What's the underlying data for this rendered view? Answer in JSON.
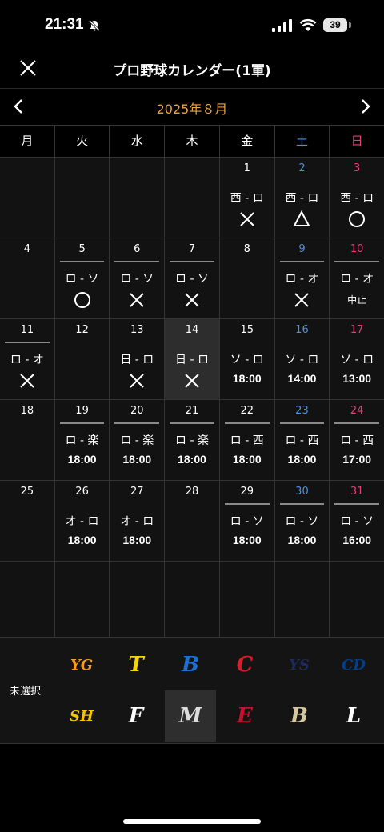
{
  "status": {
    "time": "21:31",
    "battery": "39"
  },
  "header": {
    "title": "プロ野球カレンダー(1軍)"
  },
  "calendar": {
    "month_label": "2025年８月",
    "weekdays": [
      "月",
      "火",
      "水",
      "木",
      "金",
      "土",
      "日"
    ],
    "weeks": [
      [
        {
          "day": ""
        },
        {
          "day": ""
        },
        {
          "day": ""
        },
        {
          "day": ""
        },
        {
          "day": "1",
          "match": "西 - ロ",
          "result": "x"
        },
        {
          "day": "2",
          "match": "西 - ロ",
          "result": "triangle"
        },
        {
          "day": "3",
          "match": "西 - ロ",
          "result": "o"
        }
      ],
      [
        {
          "day": "4"
        },
        {
          "day": "5",
          "match": "ロ - ソ",
          "result": "o",
          "line": true
        },
        {
          "day": "6",
          "match": "ロ - ソ",
          "result": "x",
          "line": true
        },
        {
          "day": "7",
          "match": "ロ - ソ",
          "result": "x",
          "line": true
        },
        {
          "day": "8"
        },
        {
          "day": "9",
          "match": "ロ - オ",
          "result": "x",
          "line": true
        },
        {
          "day": "10",
          "match": "ロ - オ",
          "note": "中止",
          "line": true
        }
      ],
      [
        {
          "day": "11",
          "match": "ロ - オ",
          "result": "x",
          "line": true
        },
        {
          "day": "12"
        },
        {
          "day": "13",
          "match": "日 - ロ",
          "result": "x"
        },
        {
          "day": "14",
          "match": "日 - ロ",
          "result": "x",
          "today": true
        },
        {
          "day": "15",
          "match": "ソ - ロ",
          "time": "18:00"
        },
        {
          "day": "16",
          "match": "ソ - ロ",
          "time": "14:00"
        },
        {
          "day": "17",
          "match": "ソ - ロ",
          "time": "13:00"
        }
      ],
      [
        {
          "day": "18"
        },
        {
          "day": "19",
          "match": "ロ - 楽",
          "time": "18:00",
          "line": true
        },
        {
          "day": "20",
          "match": "ロ - 楽",
          "time": "18:00",
          "line": true
        },
        {
          "day": "21",
          "match": "ロ - 楽",
          "time": "18:00",
          "line": true
        },
        {
          "day": "22",
          "match": "ロ - 西",
          "time": "18:00",
          "line": true
        },
        {
          "day": "23",
          "match": "ロ - 西",
          "time": "18:00",
          "line": true
        },
        {
          "day": "24",
          "match": "ロ - 西",
          "time": "17:00",
          "line": true
        }
      ],
      [
        {
          "day": "25"
        },
        {
          "day": "26",
          "match": "オ - ロ",
          "time": "18:00"
        },
        {
          "day": "27",
          "match": "オ - ロ",
          "time": "18:00"
        },
        {
          "day": "28"
        },
        {
          "day": "29",
          "match": "ロ - ソ",
          "time": "18:00",
          "line": true
        },
        {
          "day": "30",
          "match": "ロ - ソ",
          "time": "18:00",
          "line": true
        },
        {
          "day": "31",
          "match": "ロ - ソ",
          "time": "16:00",
          "line": true
        }
      ],
      [
        {
          "day": ""
        },
        {
          "day": ""
        },
        {
          "day": ""
        },
        {
          "day": ""
        },
        {
          "day": ""
        },
        {
          "day": ""
        },
        {
          "day": ""
        }
      ]
    ]
  },
  "teams": {
    "unselected_label": "未選択",
    "row1": [
      {
        "name": "giants-logo",
        "icon": "YG",
        "color": "#f29b1d"
      },
      {
        "name": "tigers-logo",
        "icon": "T",
        "color": "#f5d400"
      },
      {
        "name": "baystars-logo",
        "icon": "B",
        "color": "#1a6fd1"
      },
      {
        "name": "carp-logo",
        "icon": "C",
        "color": "#d91d2a"
      },
      {
        "name": "swallows-logo",
        "icon": "YS",
        "color": "#1e2a5a"
      },
      {
        "name": "dragons-logo",
        "icon": "CD",
        "color": "#003f8c"
      }
    ],
    "row2": [
      {
        "name": "hawks-logo",
        "icon": "SH",
        "color": "#f5c500"
      },
      {
        "name": "fighters-logo",
        "icon": "F",
        "color": "#ffffff"
      },
      {
        "name": "marines-logo",
        "icon": "M",
        "color": "#dddddd",
        "selected": true
      },
      {
        "name": "eagles-logo",
        "icon": "E",
        "color": "#c8102e"
      },
      {
        "name": "buffaloes-logo",
        "icon": "B",
        "color": "#d6c7a1"
      },
      {
        "name": "lions-logo",
        "icon": "L",
        "color": "#ffffff"
      }
    ]
  }
}
